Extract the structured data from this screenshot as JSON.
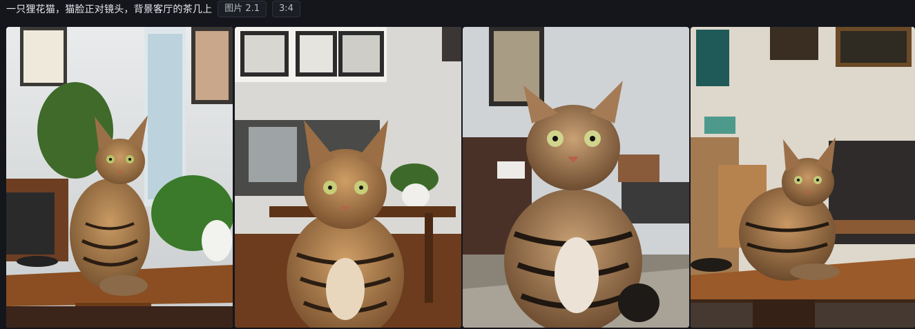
{
  "header": {
    "prompt": "一只狸花猫，猫脸正对镜头，背景客厅的茶几上",
    "model_chip": "图片 2.1",
    "ratio_chip": "3:4"
  },
  "images": [
    {
      "subject": "tabby-cat",
      "setting": "living-room-coffee-table"
    },
    {
      "subject": "tabby-cat",
      "setting": "living-room-coffee-table"
    },
    {
      "subject": "tabby-cat",
      "setting": "living-room-rug"
    },
    {
      "subject": "tabby-cat",
      "setting": "living-room-coffee-table"
    }
  ],
  "colors": {
    "background": "#14161c",
    "chip_border": "#2f333d",
    "tabby_fur": "#a27a4e"
  }
}
